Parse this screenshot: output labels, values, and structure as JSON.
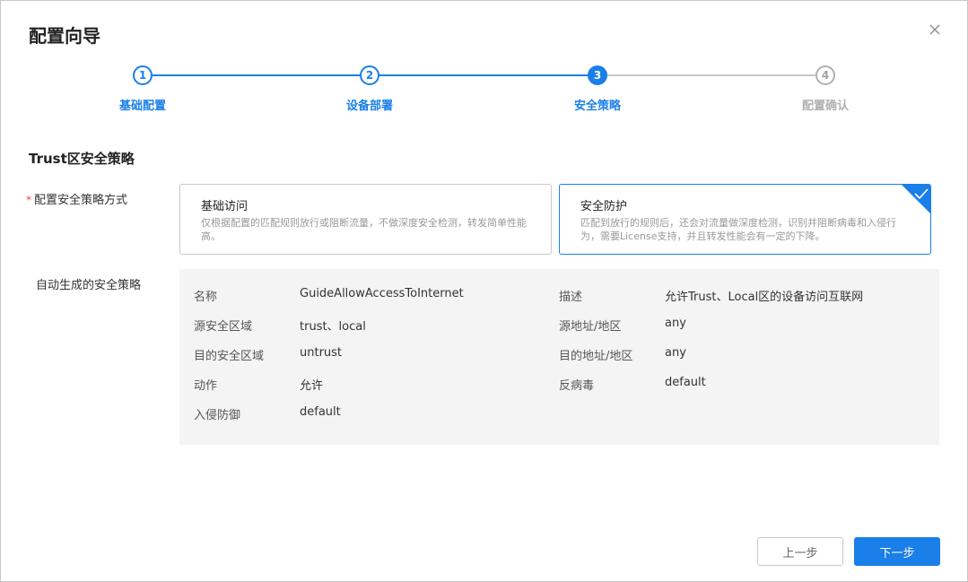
{
  "dialog": {
    "title": "配置向导"
  },
  "steps": [
    {
      "num": "1",
      "label": "基础配置",
      "state": "done"
    },
    {
      "num": "2",
      "label": "设备部署",
      "state": "done"
    },
    {
      "num": "3",
      "label": "安全策略",
      "state": "active"
    },
    {
      "num": "4",
      "label": "配置确认",
      "state": "pending"
    }
  ],
  "section": {
    "title": "Trust区安全策略"
  },
  "form": {
    "mode_label": "配置安全策略方式",
    "required_mark": "*",
    "auto_label": "自动生成的安全策略"
  },
  "options": [
    {
      "title": "基础访问",
      "desc": "仅根据配置的匹配规则放行或阻断流量，不做深度安全检测，转发简单性能高。",
      "selected": false
    },
    {
      "title": "安全防护",
      "desc": "匹配到放行的规则后，还会对流量做深度检测，识别并阻断病毒和入侵行为，需要License支持，并且转发性能会有一定的下降。",
      "selected": true
    }
  ],
  "policy": {
    "name_k": "名称",
    "name_v": "GuideAllowAccessToInternet",
    "desc_k": "描述",
    "desc_v": "允许Trust、Local区的设备访问互联网",
    "src_zone_k": "源安全区域",
    "src_zone_v": "trust、local",
    "src_addr_k": "源地址/地区",
    "src_addr_v": "any",
    "dst_zone_k": "目的安全区域",
    "dst_zone_v": "untrust",
    "dst_addr_k": "目的地址/地区",
    "dst_addr_v": "any",
    "action_k": "动作",
    "action_v": "允许",
    "av_k": "反病毒",
    "av_v": "default",
    "ips_k": "入侵防御",
    "ips_v": "default"
  },
  "buttons": {
    "prev": "上一步",
    "next": "下一步"
  },
  "colors": {
    "accent": "#1a7fe8",
    "pending": "#b0b0b0",
    "panel_bg": "#f4f4f4"
  }
}
